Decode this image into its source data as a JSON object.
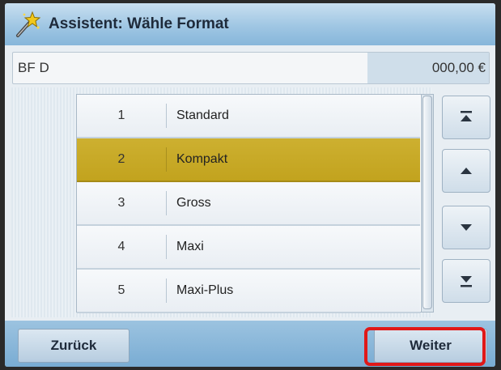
{
  "header": {
    "title": "Assistent: Wähle Format",
    "icon": "wand-icon"
  },
  "info": {
    "code": "BF D",
    "amount": "000,00 €"
  },
  "formats": [
    {
      "number": "1",
      "name": "Standard",
      "selected": false
    },
    {
      "number": "2",
      "name": "Kompakt",
      "selected": true
    },
    {
      "number": "3",
      "name": "Gross",
      "selected": false
    },
    {
      "number": "4",
      "name": "Maxi",
      "selected": false
    },
    {
      "number": "5",
      "name": "Maxi-Plus",
      "selected": false
    }
  ],
  "nav": {
    "top_icon": "double-chevron-up-icon",
    "up_icon": "chevron-up-icon",
    "down_icon": "chevron-down-icon",
    "bottom_icon": "double-chevron-down-icon"
  },
  "footer": {
    "back_label": "Zurück",
    "next_label": "Weiter"
  },
  "colors": {
    "selected_row": "#c2a31e",
    "highlight": "#e01818",
    "accent": "#86b6da"
  }
}
